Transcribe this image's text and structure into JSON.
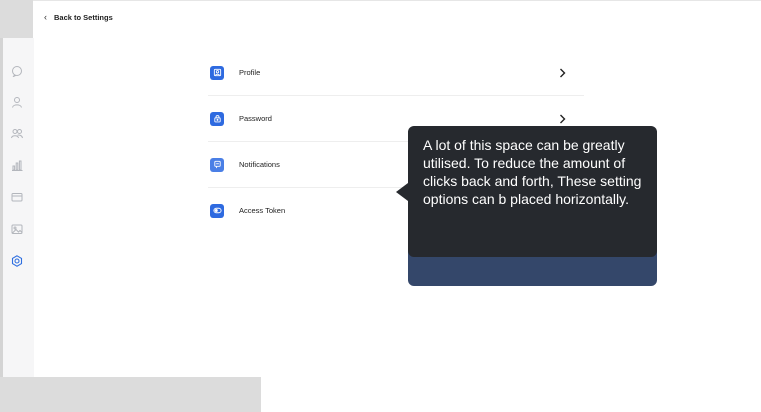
{
  "header": {
    "back_label": "Back to Settings"
  },
  "sidebar": {
    "items": [
      {
        "icon": "chat-icon"
      },
      {
        "icon": "user-icon"
      },
      {
        "icon": "users-icon"
      },
      {
        "icon": "bar-chart-icon"
      },
      {
        "icon": "card-icon"
      },
      {
        "icon": "image-icon"
      },
      {
        "icon": "gear-icon",
        "active": true
      }
    ]
  },
  "settings": {
    "items": [
      {
        "label": "Profile",
        "icon": "profile-icon"
      },
      {
        "label": "Password",
        "icon": "lock-icon"
      },
      {
        "label": "Notifications",
        "icon": "notification-icon"
      },
      {
        "label": "Access Token",
        "icon": "token-icon"
      }
    ]
  },
  "annotation": {
    "text": "A lot of this space can be greatly utilised. To reduce the amount of clicks back and forth, These setting options can b placed horizontally."
  },
  "colors": {
    "accent": "#2e6ae0",
    "tooltip_bg": "#26292e",
    "tooltip_secondary": "#34476a",
    "sidebar_bg": "#f6f6f7"
  }
}
